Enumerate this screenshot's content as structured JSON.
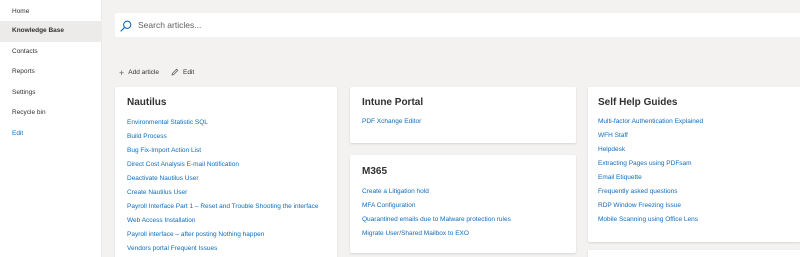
{
  "nav": {
    "items": [
      {
        "label": "Home"
      },
      {
        "label": "Knowledge Base"
      },
      {
        "label": "Contacts"
      },
      {
        "label": "Reports"
      },
      {
        "label": "Settings"
      },
      {
        "label": "Recycle bin"
      },
      {
        "label": "Edit"
      }
    ]
  },
  "search": {
    "placeholder": "Search articles...",
    "icon": "search-icon"
  },
  "commands": {
    "add_label": "Add article",
    "add_icon": "plus-icon",
    "edit_label": "Edit",
    "edit_icon": "pencil-icon"
  },
  "cards": {
    "nautilus": {
      "title": "Nautilus",
      "links": [
        "Environmental Statistic SQL",
        "Build Process",
        "Bug Fix-Import Action List",
        "Direct Cost Analysis E-mail Notification",
        "Deactivate Nautilus User",
        "Create Nautilus User",
        "Payroll Interface Part 1 – Reset and Trouble Shooting the interface",
        "Web Access Installation",
        "Payroll interface – after posting Nothing happen",
        "Vendors portal Frequent Issues"
      ]
    },
    "intune": {
      "title": "Intune Portal",
      "links": [
        "PDF Xchange Editor"
      ]
    },
    "m365": {
      "title": "M365",
      "links": [
        "Create a Litigation hold",
        "MFA Configuration",
        "Quarantined emails due to Malware protection rules",
        "Migrate User/Shared Mailbox to EXO"
      ]
    },
    "selfhelp": {
      "title": "Self Help Guides",
      "links": [
        "Multi-factor Authentication Explained",
        "WFH Staff",
        "Helpdesk",
        "Extracting Pages using PDFsam",
        "Email Etiquette",
        "Frequently asked questions",
        "RDP Window Freezing Issue",
        "Mobile Scanning using Office Lens"
      ]
    }
  },
  "colors": {
    "link": "#0f6cbd",
    "background": "#f3f2f1",
    "nav_active": "#edebe9"
  }
}
